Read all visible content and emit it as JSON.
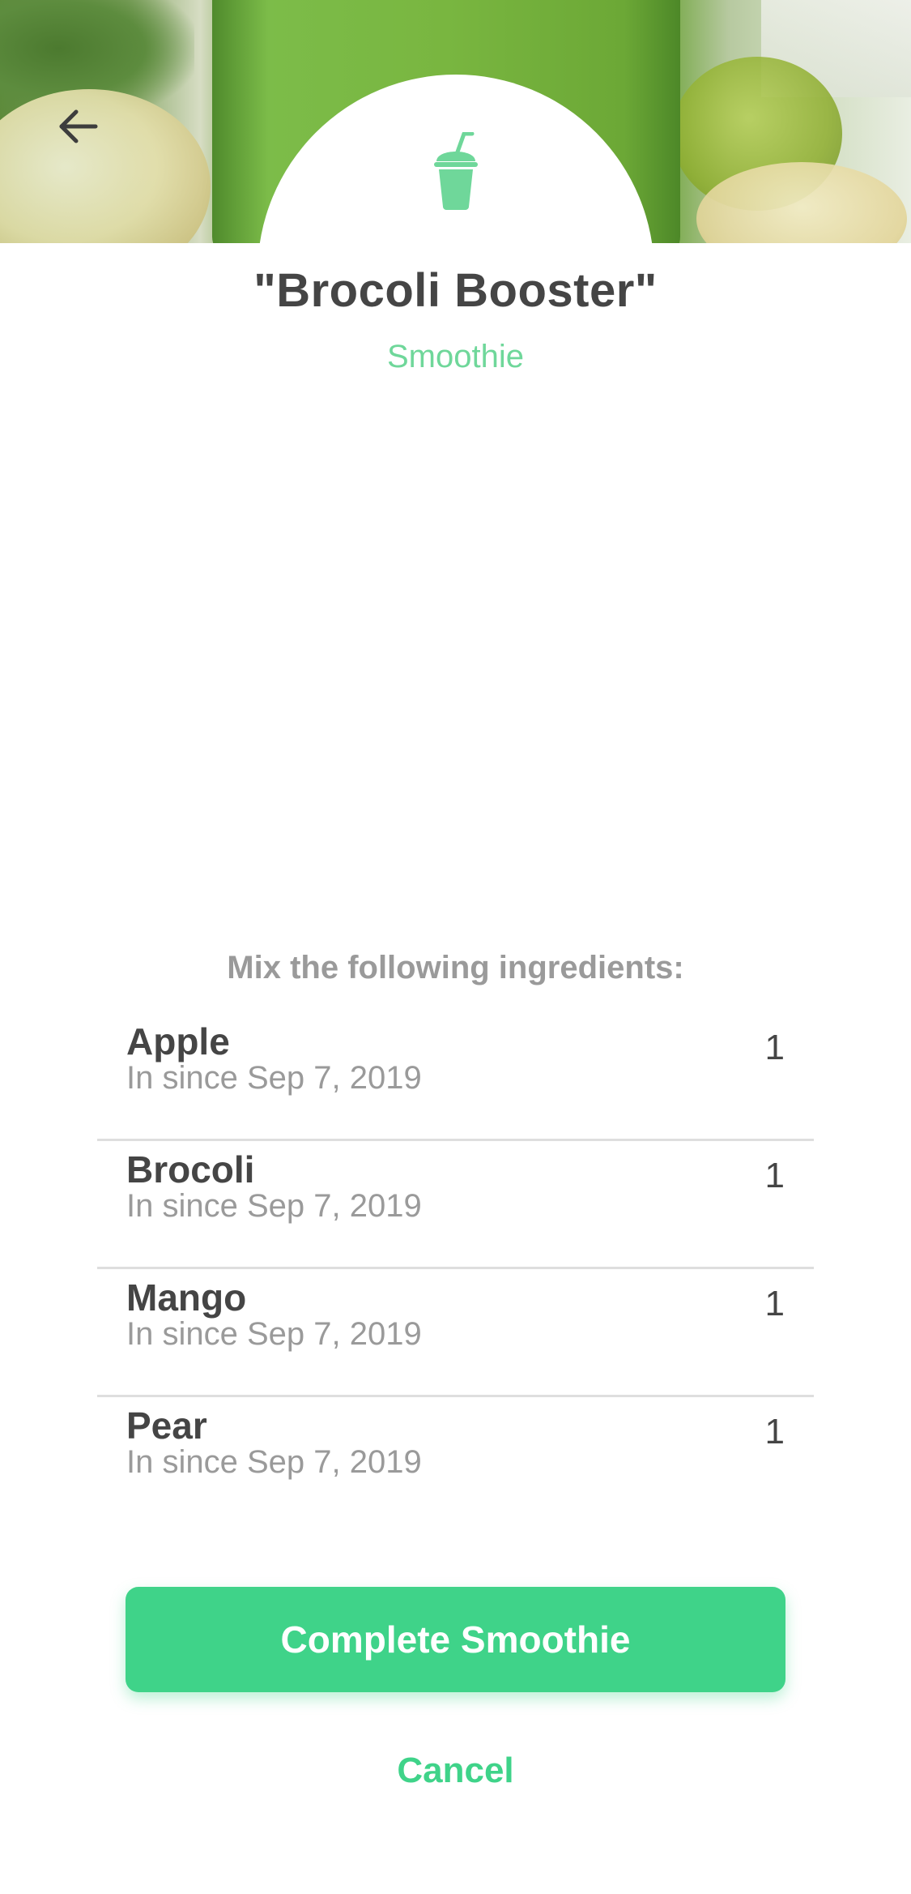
{
  "header": {
    "back_icon": "arrow-left-icon",
    "badge_icon": "smoothie-cup-icon",
    "accent_color": "#3fd389"
  },
  "recipe": {
    "title": "\"Brocoli Booster\"",
    "type": "Smoothie"
  },
  "ingredients_section": {
    "heading": "Mix the following ingredients:",
    "items": [
      {
        "name": "Apple",
        "since": "In since Sep 7, 2019",
        "quantity": "1"
      },
      {
        "name": "Brocoli",
        "since": "In since Sep 7, 2019",
        "quantity": "1"
      },
      {
        "name": "Mango",
        "since": "In since Sep 7, 2019",
        "quantity": "1"
      },
      {
        "name": "Pear",
        "since": "In since Sep 7, 2019",
        "quantity": "1"
      }
    ]
  },
  "actions": {
    "complete_label": "Complete Smoothie",
    "cancel_label": "Cancel"
  }
}
